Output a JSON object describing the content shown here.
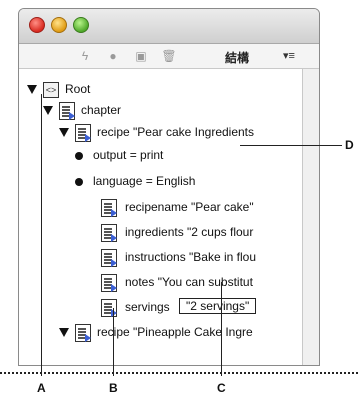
{
  "window": {
    "panel_title": "結構",
    "panel_menu": "▾≡",
    "toolbar_icons": [
      "lightning-icon",
      "bullet-icon",
      "insert-element-icon",
      "trash-icon"
    ]
  },
  "tree": {
    "items": [
      {
        "kind": "root",
        "label": "Root"
      },
      {
        "kind": "element",
        "label": "chapter"
      },
      {
        "kind": "element",
        "label": "recipe  \"Pear cake Ingredients"
      },
      {
        "kind": "attribute",
        "label": "output = print"
      },
      {
        "kind": "attribute",
        "label": "language = English"
      },
      {
        "kind": "element",
        "label": "recipename  \"Pear cake\""
      },
      {
        "kind": "element",
        "label": "ingredients  \"2 cups flour"
      },
      {
        "kind": "element",
        "label": "instructions  \"Bake in flou"
      },
      {
        "kind": "element",
        "label": "notes  \"You can substitut"
      },
      {
        "kind": "element",
        "label": "servings",
        "value": "\"2 servings\""
      },
      {
        "kind": "element",
        "label": "recipe  \"Pineapple Cake Ingre"
      }
    ]
  },
  "callouts": {
    "a": "A",
    "b": "B",
    "c": "C",
    "d": "D"
  }
}
